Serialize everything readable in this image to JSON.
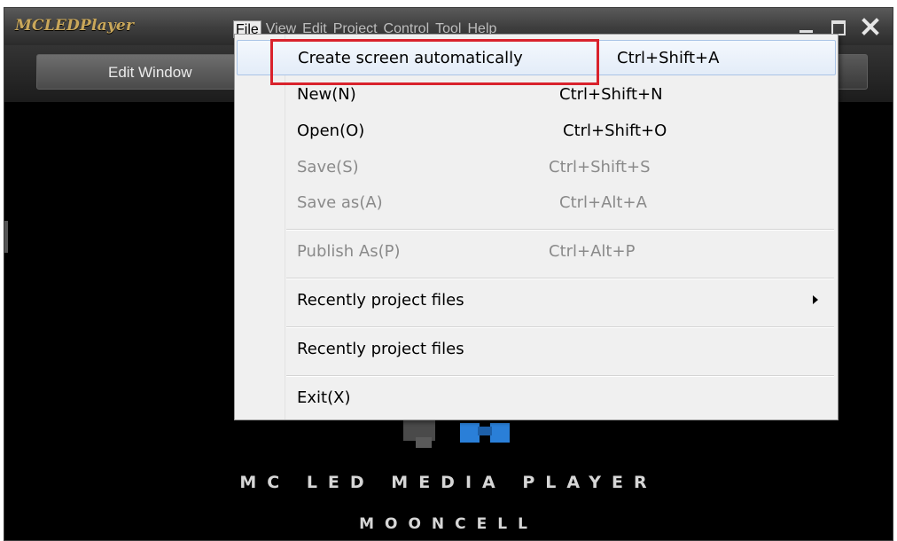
{
  "app": {
    "title": "MCLEDPlayer"
  },
  "menubar": [
    "File",
    "View",
    "Edit",
    "Project",
    "Control",
    "Tool",
    "Help"
  ],
  "toolbar": {
    "edit_tab": "Edit Window"
  },
  "file_menu": {
    "items": [
      {
        "label": "Create screen automatically",
        "shortcut": "Ctrl+Shift+A",
        "enabled": true,
        "highlighted": true
      },
      {
        "label": "New(N)",
        "shortcut": "Ctrl+Shift+N",
        "enabled": true
      },
      {
        "label": "Open(O)",
        "shortcut": "Ctrl+Shift+O",
        "enabled": true
      },
      {
        "label": "Save(S)",
        "shortcut": "Ctrl+Shift+S",
        "enabled": false
      },
      {
        "label": "Save as(A)",
        "shortcut": "Ctrl+Alt+A",
        "enabled": false
      },
      {
        "label": "Publish As(P)",
        "shortcut": "Ctrl+Alt+P",
        "enabled": false
      },
      {
        "label": "Recently project files",
        "shortcut": "",
        "enabled": true,
        "submenu": true
      },
      {
        "label": "Recently project files",
        "shortcut": "",
        "enabled": true
      },
      {
        "label": "Exit(X)",
        "shortcut": "",
        "enabled": true
      }
    ]
  },
  "splash": {
    "title": "MC LED MEDIA PLAYER",
    "subtitle": "MOONCELL"
  },
  "colors": {
    "highlight_box": "#d9222c",
    "title_gold": "#c9a75a",
    "background": "#000000"
  }
}
